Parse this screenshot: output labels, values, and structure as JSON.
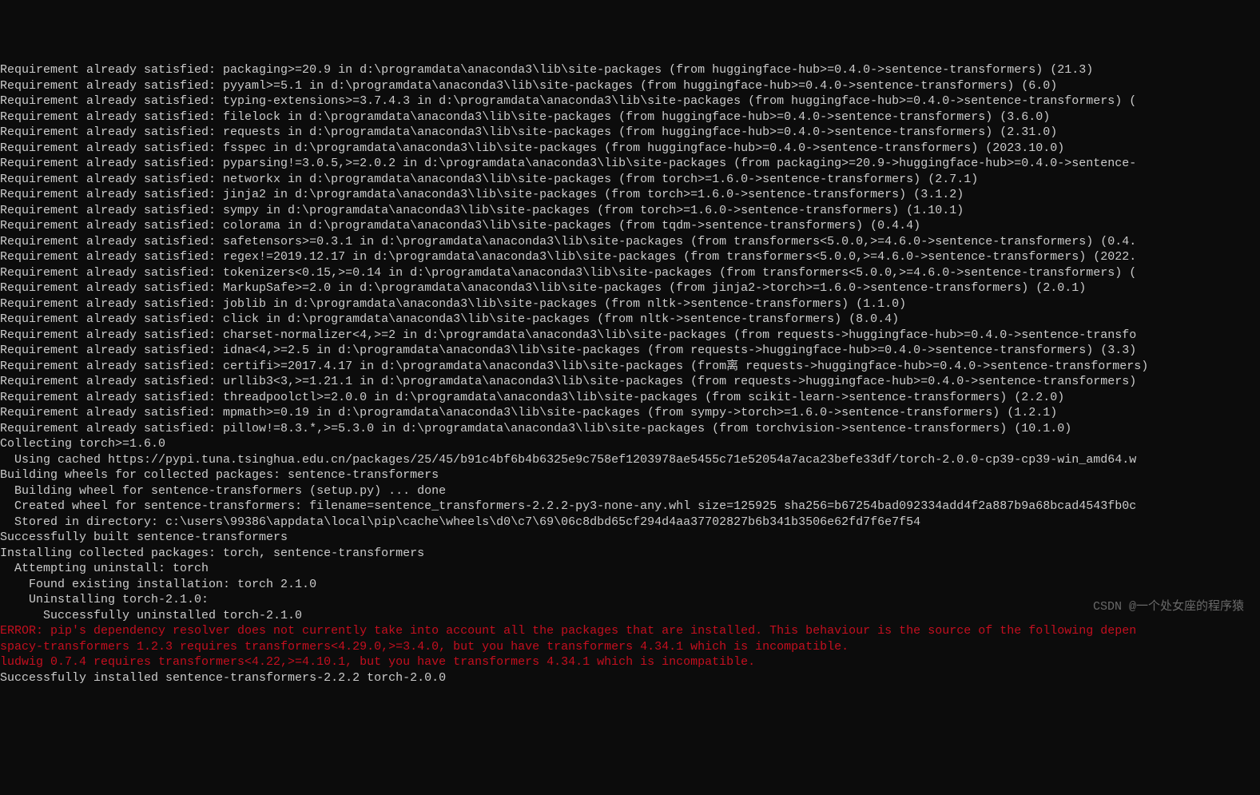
{
  "terminal": {
    "lines": [
      {
        "text": "Requirement already satisfied: packaging>=20.9 in d:\\programdata\\anaconda3\\lib\\site-packages (from huggingface-hub>=0.4.0->sentence-transformers) (21.3)",
        "type": "normal"
      },
      {
        "text": "Requirement already satisfied: pyyaml>=5.1 in d:\\programdata\\anaconda3\\lib\\site-packages (from huggingface-hub>=0.4.0->sentence-transformers) (6.0)",
        "type": "normal"
      },
      {
        "text": "Requirement already satisfied: typing-extensions>=3.7.4.3 in d:\\programdata\\anaconda3\\lib\\site-packages (from huggingface-hub>=0.4.0->sentence-transformers) (",
        "type": "normal"
      },
      {
        "text": "Requirement already satisfied: filelock in d:\\programdata\\anaconda3\\lib\\site-packages (from huggingface-hub>=0.4.0->sentence-transformers) (3.6.0)",
        "type": "normal"
      },
      {
        "text": "Requirement already satisfied: requests in d:\\programdata\\anaconda3\\lib\\site-packages (from huggingface-hub>=0.4.0->sentence-transformers) (2.31.0)",
        "type": "normal"
      },
      {
        "text": "Requirement already satisfied: fsspec in d:\\programdata\\anaconda3\\lib\\site-packages (from huggingface-hub>=0.4.0->sentence-transformers) (2023.10.0)",
        "type": "normal"
      },
      {
        "text": "Requirement already satisfied: pyparsing!=3.0.5,>=2.0.2 in d:\\programdata\\anaconda3\\lib\\site-packages (from packaging>=20.9->huggingface-hub>=0.4.0->sentence-",
        "type": "normal"
      },
      {
        "text": "Requirement already satisfied: networkx in d:\\programdata\\anaconda3\\lib\\site-packages (from torch>=1.6.0->sentence-transformers) (2.7.1)",
        "type": "normal"
      },
      {
        "text": "Requirement already satisfied: jinja2 in d:\\programdata\\anaconda3\\lib\\site-packages (from torch>=1.6.0->sentence-transformers) (3.1.2)",
        "type": "normal"
      },
      {
        "text": "Requirement already satisfied: sympy in d:\\programdata\\anaconda3\\lib\\site-packages (from torch>=1.6.0->sentence-transformers) (1.10.1)",
        "type": "normal"
      },
      {
        "text": "Requirement already satisfied: colorama in d:\\programdata\\anaconda3\\lib\\site-packages (from tqdm->sentence-transformers) (0.4.4)",
        "type": "normal"
      },
      {
        "text": "Requirement already satisfied: safetensors>=0.3.1 in d:\\programdata\\anaconda3\\lib\\site-packages (from transformers<5.0.0,>=4.6.0->sentence-transformers) (0.4.",
        "type": "normal"
      },
      {
        "text": "Requirement already satisfied: regex!=2019.12.17 in d:\\programdata\\anaconda3\\lib\\site-packages (from transformers<5.0.0,>=4.6.0->sentence-transformers) (2022.",
        "type": "normal"
      },
      {
        "text": "Requirement already satisfied: tokenizers<0.15,>=0.14 in d:\\programdata\\anaconda3\\lib\\site-packages (from transformers<5.0.0,>=4.6.0->sentence-transformers) (",
        "type": "normal"
      },
      {
        "text": "Requirement already satisfied: MarkupSafe>=2.0 in d:\\programdata\\anaconda3\\lib\\site-packages (from jinja2->torch>=1.6.0->sentence-transformers) (2.0.1)",
        "type": "normal"
      },
      {
        "text": "Requirement already satisfied: joblib in d:\\programdata\\anaconda3\\lib\\site-packages (from nltk->sentence-transformers) (1.1.0)",
        "type": "normal"
      },
      {
        "text": "Requirement already satisfied: click in d:\\programdata\\anaconda3\\lib\\site-packages (from nltk->sentence-transformers) (8.0.4)",
        "type": "normal"
      },
      {
        "text": "Requirement already satisfied: charset-normalizer<4,>=2 in d:\\programdata\\anaconda3\\lib\\site-packages (from requests->huggingface-hub>=0.4.0->sentence-transfo",
        "type": "normal"
      },
      {
        "text": "Requirement already satisfied: idna<4,>=2.5 in d:\\programdata\\anaconda3\\lib\\site-packages (from requests->huggingface-hub>=0.4.0->sentence-transformers) (3.3)",
        "type": "normal"
      },
      {
        "text": "Requirement already satisfied: certifi>=2017.4.17 in d:\\programdata\\anaconda3\\lib\\site-packages (from离 requests->huggingface-hub>=0.4.0->sentence-transformers)",
        "type": "normal"
      },
      {
        "text": "Requirement already satisfied: urllib3<3,>=1.21.1 in d:\\programdata\\anaconda3\\lib\\site-packages (from requests->huggingface-hub>=0.4.0->sentence-transformers)",
        "type": "normal"
      },
      {
        "text": "Requirement already satisfied: threadpoolctl>=2.0.0 in d:\\programdata\\anaconda3\\lib\\site-packages (from scikit-learn->sentence-transformers) (2.2.0)",
        "type": "normal"
      },
      {
        "text": "Requirement already satisfied: mpmath>=0.19 in d:\\programdata\\anaconda3\\lib\\site-packages (from sympy->torch>=1.6.0->sentence-transformers) (1.2.1)",
        "type": "normal"
      },
      {
        "text": "Requirement already satisfied: pillow!=8.3.*,>=5.3.0 in d:\\programdata\\anaconda3\\lib\\site-packages (from torchvision->sentence-transformers) (10.1.0)",
        "type": "normal"
      },
      {
        "text": "Collecting torch>=1.6.0",
        "type": "normal"
      },
      {
        "text": "  Using cached https://pypi.tuna.tsinghua.edu.cn/packages/25/45/b91c4bf6b4b6325e9c758ef1203978ae5455c71e52054a7aca23befe33df/torch-2.0.0-cp39-cp39-win_amd64.w",
        "type": "normal"
      },
      {
        "text": "Building wheels for collected packages: sentence-transformers",
        "type": "normal"
      },
      {
        "text": "  Building wheel for sentence-transformers (setup.py) ... done",
        "type": "normal"
      },
      {
        "text": "  Created wheel for sentence-transformers: filename=sentence_transformers-2.2.2-py3-none-any.whl size=125925 sha256=b67254bad092334add4f2a887b9a68bcad4543fb0c",
        "type": "normal"
      },
      {
        "text": "  Stored in directory: c:\\users\\99386\\appdata\\local\\pip\\cache\\wheels\\d0\\c7\\69\\06c8dbd65cf294d4aa37702827b6b341b3506e62fd7f6e7f54",
        "type": "normal"
      },
      {
        "text": "Successfully built sentence-transformers",
        "type": "normal"
      },
      {
        "text": "Installing collected packages: torch, sentence-transformers",
        "type": "normal"
      },
      {
        "text": "  Attempting uninstall: torch",
        "type": "normal"
      },
      {
        "text": "    Found existing installation: torch 2.1.0",
        "type": "normal"
      },
      {
        "text": "    Uninstalling torch-2.1.0:",
        "type": "normal"
      },
      {
        "text": "      Successfully uninstalled torch-2.1.0",
        "type": "normal"
      },
      {
        "text": "ERROR: pip's dependency resolver does not currently take into account all the packages that are installed. This behaviour is the source of the following depen",
        "type": "error"
      },
      {
        "text": "spacy-transformers 1.2.3 requires transformers<4.29.0,>=3.4.0, but you have transformers 4.34.1 which is incompatible.",
        "type": "error"
      },
      {
        "text": "ludwig 0.7.4 requires transformers<4.22,>=4.10.1, but you have transformers 4.34.1 which is incompatible.",
        "type": "error"
      },
      {
        "text": "Successfully installed sentence-transformers-2.2.2 torch-2.0.0",
        "type": "normal"
      }
    ]
  },
  "watermark": "CSDN @一个处女座的程序猿"
}
